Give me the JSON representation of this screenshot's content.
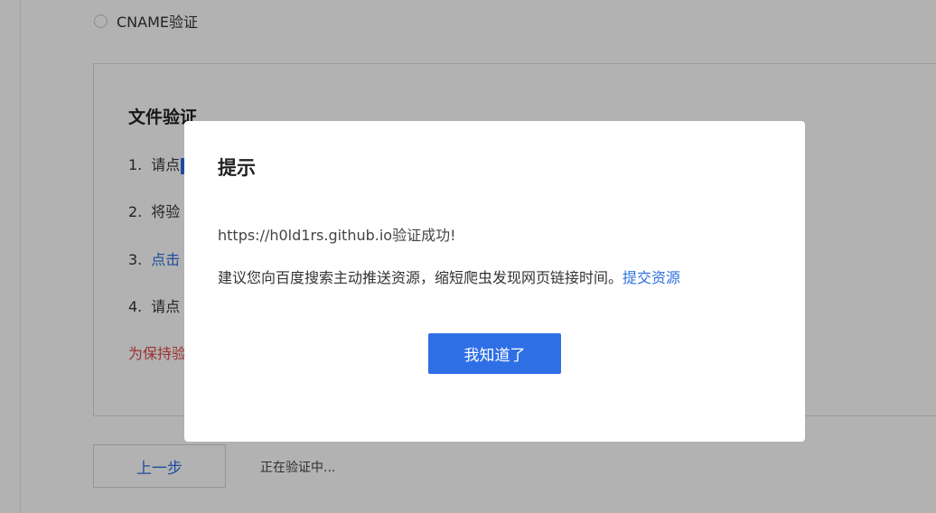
{
  "background": {
    "cname_option_label": "CNAME验证",
    "file_verify_title": "文件验证",
    "steps": [
      {
        "num": "1.",
        "text": "请点"
      },
      {
        "num": "2.",
        "text": "将验"
      },
      {
        "num": "3.",
        "text": "点击"
      },
      {
        "num": "4.",
        "text": "请点"
      }
    ],
    "warning_text": "为保持验",
    "prev_button_label": "上一步",
    "status_text": "正在验证中..."
  },
  "dialog": {
    "title": "提示",
    "success_message": "https://h0ld1rs.github.io验证成功!",
    "suggestion_text": "建议您向百度搜索主动推送资源，缩短爬虫发现网页链接时间。",
    "submit_link_label": "提交资源",
    "ok_button_label": "我知道了"
  },
  "colors": {
    "accent": "#2f6fe6",
    "link": "#2d6fe0",
    "warning": "#e04a4a",
    "overlay": "rgba(0,0,0,0.30)"
  }
}
